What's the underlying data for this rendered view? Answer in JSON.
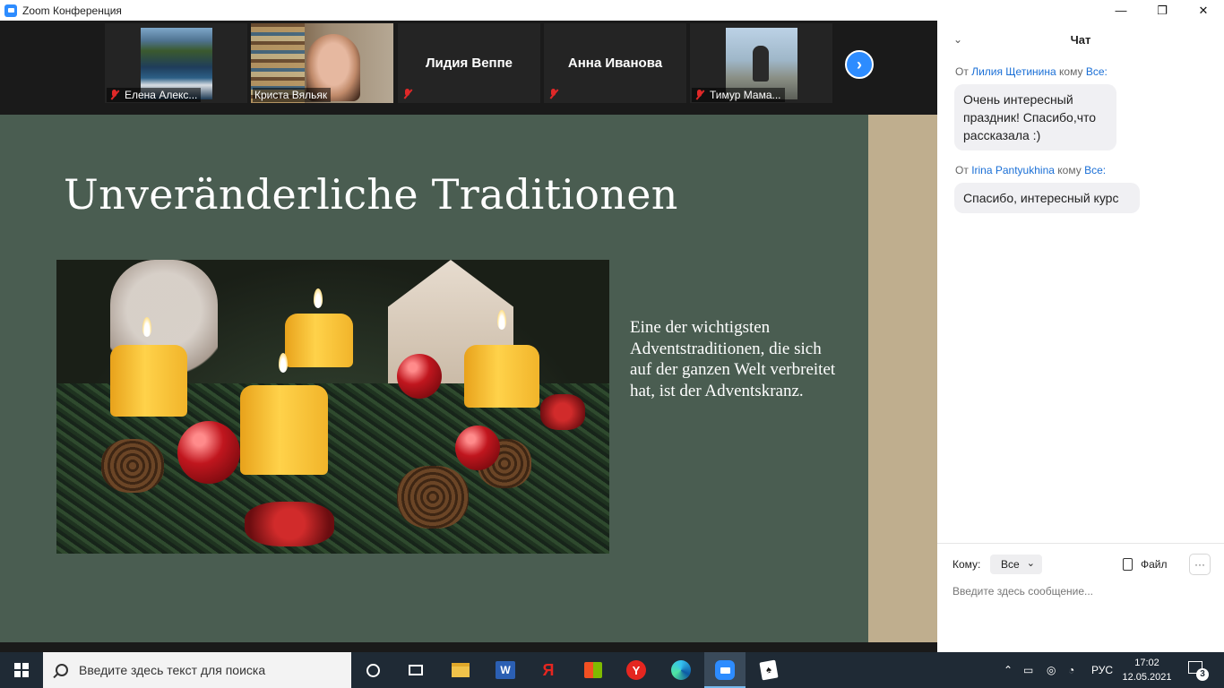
{
  "window": {
    "title": "Zoom Конференция",
    "controls": {
      "minimize": "—",
      "restore": "❐",
      "close": "✕"
    }
  },
  "gallery": {
    "participants": [
      {
        "name": "Елена Алекс...",
        "muted": true,
        "video": "landscape"
      },
      {
        "name": "Криста Вяльяк",
        "muted": false,
        "video": "person"
      },
      {
        "name": "Лидия Веппе",
        "muted": true,
        "video": "none"
      },
      {
        "name": "Анна Иванова",
        "muted": true,
        "video": "none"
      },
      {
        "name": "Тимур Мама...",
        "muted": true,
        "video": "skater"
      }
    ],
    "next_icon": "›"
  },
  "slide": {
    "title": "Unveränderliche Traditionen",
    "body": "Eine der wichtigsten Adventstraditionen, die sich auf der ganzen Welt verbreitet hat, ist der Adventskranz.",
    "bg_color": "#4a5d51",
    "side_color": "#bfae8e"
  },
  "chat": {
    "title": "Чат",
    "collapse_icon": "⌄",
    "messages": [
      {
        "from_prefix": "От",
        "from": "Лилия Щетинина",
        "to_prefix": "кому",
        "to": "Все:",
        "text": "Очень интересный праздник! Спасибо,что рассказала :)"
      },
      {
        "from_prefix": "От",
        "from": "Irina Pantyukhina",
        "to_prefix": "кому",
        "to": "Все:",
        "text": "Спасибо, интересный курс"
      }
    ],
    "to_label": "Кому:",
    "to_value": "Все",
    "file_label": "Файл",
    "more_label": "···",
    "input_placeholder": "Введите здесь сообщение..."
  },
  "taskbar": {
    "search_placeholder": "Введите здесь текст для поиска",
    "lang": "РУС",
    "time": "17:02",
    "date": "12.05.2021",
    "notifications": "3"
  }
}
